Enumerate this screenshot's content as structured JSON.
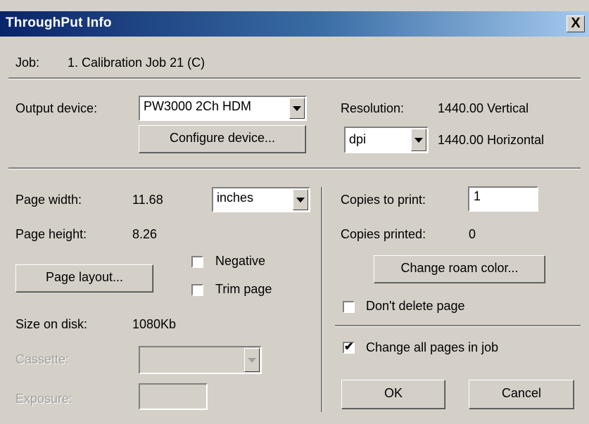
{
  "window": {
    "title": "ThroughPut Info",
    "close_glyph": "X"
  },
  "job": {
    "label": "Job:",
    "value": "1. Calibration Job 21 (C)"
  },
  "output": {
    "device_label": "Output device:",
    "device_value": "PW3000 2Ch HDM",
    "configure_label": "Configure device...",
    "resolution_label": "Resolution:",
    "resolution_vertical": "1440.00 Vertical",
    "resolution_horizontal": "1440.00 Horizontal",
    "unit_value": "dpi"
  },
  "page": {
    "width_label": "Page width:",
    "width_value": "11.68",
    "unit_value": "inches",
    "height_label": "Page height:",
    "height_value": "8.26",
    "layout_label": "Page layout...",
    "negative_label": "Negative",
    "negative_checked": false,
    "trim_label": "Trim page",
    "trim_checked": false,
    "size_label": "Size on disk:",
    "size_value": "1080Kb",
    "cassette_label": "Cassette:",
    "cassette_value": "",
    "exposure_label": "Exposure:",
    "exposure_value": ""
  },
  "copies": {
    "to_print_label": "Copies to print:",
    "to_print_value": "1",
    "printed_label": "Copies printed:",
    "printed_value": "0",
    "roam_label": "Change roam color...",
    "dont_delete_label": "Don't delete page",
    "dont_delete_checked": false,
    "change_all_label": "Change all pages in job",
    "change_all_checked": true,
    "check_glyph": "✔"
  },
  "buttons": {
    "ok": "OK",
    "cancel": "Cancel"
  }
}
